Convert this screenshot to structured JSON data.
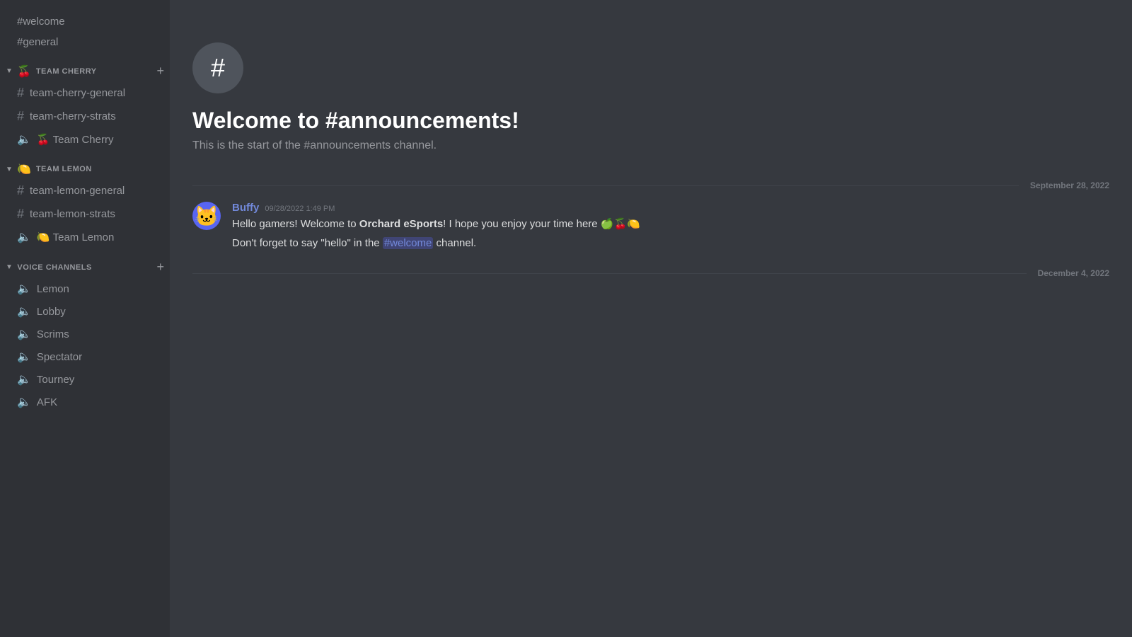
{
  "sidebar": {
    "channels_top": [
      {
        "id": "welcome",
        "name": "welcome",
        "type": "text"
      },
      {
        "id": "general",
        "name": "general",
        "type": "text"
      }
    ],
    "categories": [
      {
        "id": "team-cherry",
        "name": "TEAM CHERRY",
        "emoji": "🍒",
        "chevron": "▼",
        "channels": [
          {
            "id": "team-cherry-general",
            "name": "team-cherry-general",
            "type": "text"
          },
          {
            "id": "team-cherry-strats",
            "name": "team-cherry-strats",
            "type": "text"
          },
          {
            "id": "team-cherry-voice",
            "name": "Team Cherry",
            "type": "voice",
            "emoji": "🍒"
          }
        ]
      },
      {
        "id": "team-lemon",
        "name": "TEAM LEMON",
        "emoji": "🍋",
        "chevron": "▼",
        "channels": [
          {
            "id": "team-lemon-general",
            "name": "team-lemon-general",
            "type": "text"
          },
          {
            "id": "team-lemon-strats",
            "name": "team-lemon-strats",
            "type": "text"
          },
          {
            "id": "team-lemon-voice",
            "name": "Team Lemon",
            "type": "voice",
            "emoji": "🍋"
          }
        ]
      },
      {
        "id": "voice-channels",
        "name": "VOICE CHANNELS",
        "emoji": "",
        "chevron": "▼",
        "channels": [
          {
            "id": "lemon-vc",
            "name": "Lemon",
            "type": "voice"
          },
          {
            "id": "lobby-vc",
            "name": "Lobby",
            "type": "voice"
          },
          {
            "id": "scrims-vc",
            "name": "Scrims",
            "type": "voice"
          },
          {
            "id": "spectator-vc",
            "name": "Spectator",
            "type": "voice"
          },
          {
            "id": "tourney-vc",
            "name": "Tourney",
            "type": "voice"
          },
          {
            "id": "afk-vc",
            "name": "AFK",
            "type": "voice"
          }
        ]
      }
    ]
  },
  "main": {
    "welcome_icon": "#",
    "welcome_title": "Welcome to #announcements!",
    "welcome_subtitle": "This is the start of the #announcements channel.",
    "date_divider_1": "September 28, 2022",
    "date_divider_2": "December 4, 2022",
    "messages": [
      {
        "id": "msg1",
        "author": "Buffy",
        "author_color": "#7289da",
        "timestamp": "09/28/2022 1:49 PM",
        "lines": [
          "Hello gamers! Welcome to Orchard eSports! I hope you enjoy your time here 🍏🍒🍋",
          "Don't forget to say \"hello\" in the #welcome channel."
        ]
      }
    ]
  }
}
